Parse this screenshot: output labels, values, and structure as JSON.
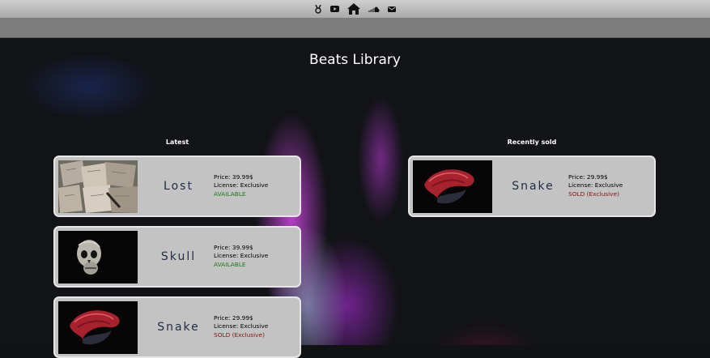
{
  "nav": {
    "icons": [
      "award-icon",
      "youtube-icon",
      "home-icon",
      "soundcloud-icon",
      "mail-icon"
    ]
  },
  "page": {
    "title": "Beats Library"
  },
  "latest": {
    "heading": "Latest",
    "items": [
      {
        "name": "Lost",
        "price": "Price: 39.99$",
        "license": "License: Exclusive",
        "status": "AVAILABLE"
      },
      {
        "name": "Skull",
        "price": "Price: 39.99$",
        "license": "License: Exclusive",
        "status": "AVAILABLE"
      },
      {
        "name": "Snake",
        "price": "Price: 29.99$",
        "license": "License: Exclusive",
        "status": "SOLD (Exclusive)"
      }
    ]
  },
  "recently_sold": {
    "heading": "Recently sold",
    "items": [
      {
        "name": "Snake",
        "price": "Price: 29.99$",
        "license": "License: Exclusive",
        "status": "SOLD (Exclusive)"
      }
    ]
  },
  "colors": {
    "card_bg": "#c3c3c3",
    "available": "#1e7a1e",
    "sold": "#8a1010",
    "title_text": "#1f2c45"
  }
}
